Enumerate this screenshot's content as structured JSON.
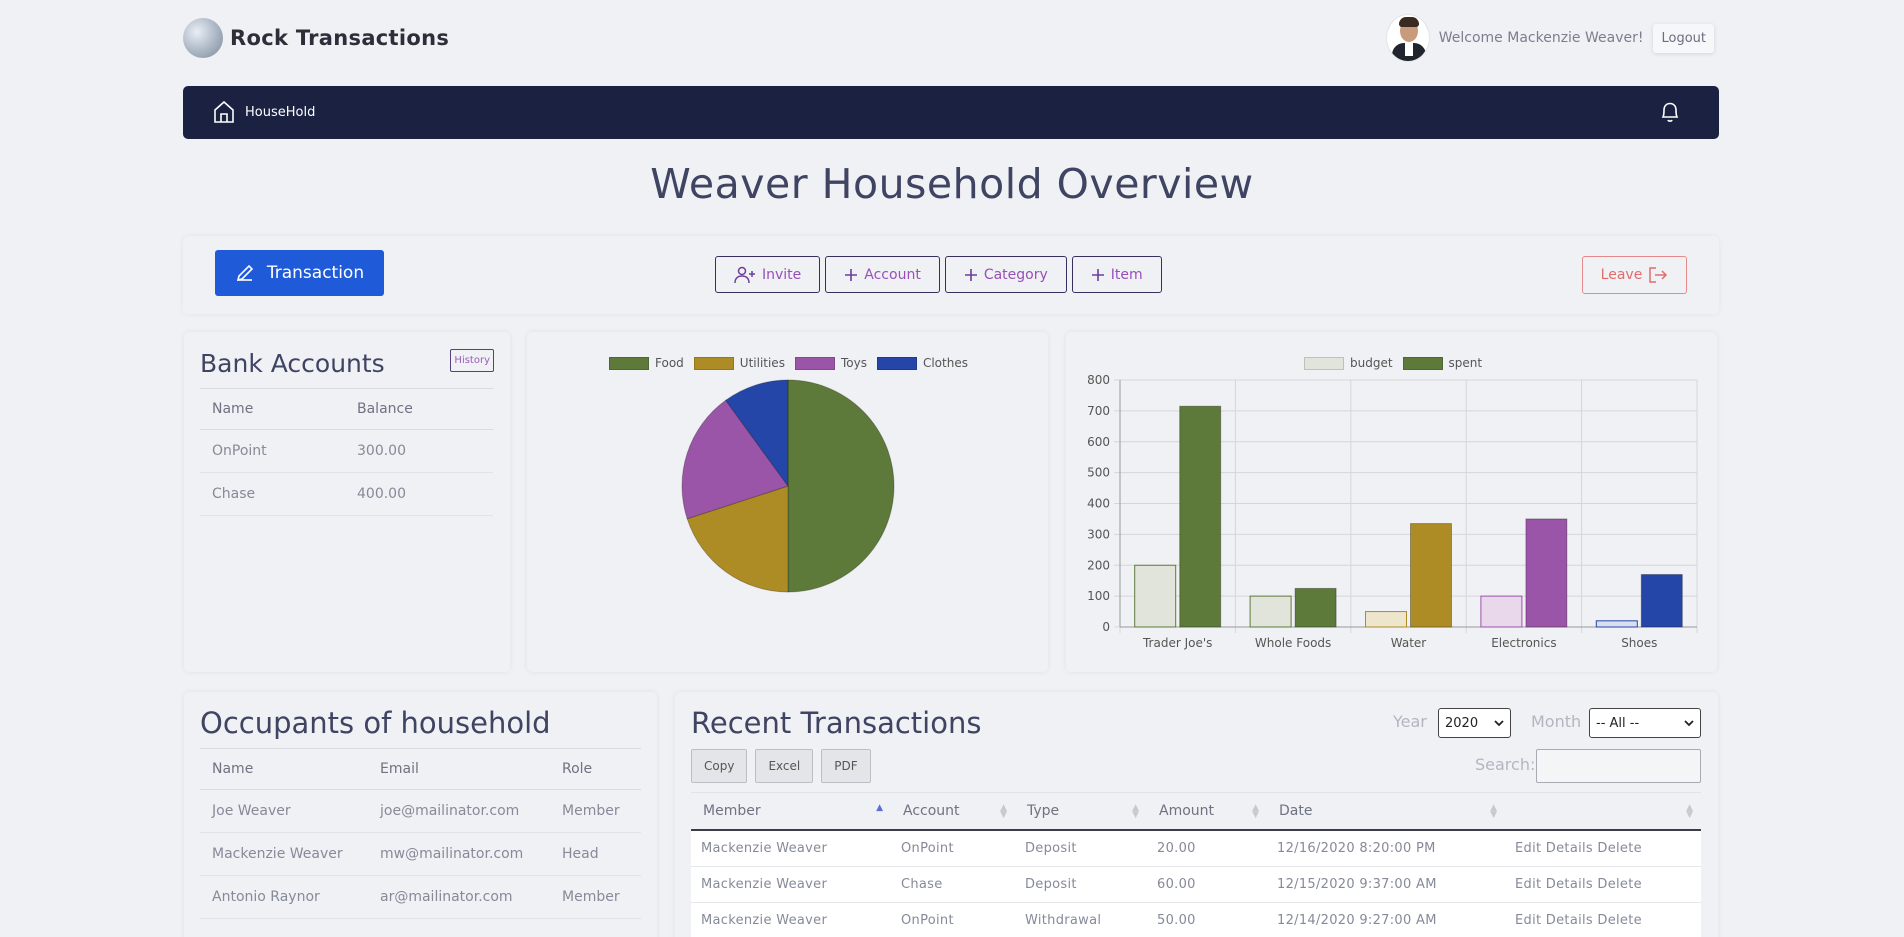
{
  "brand": {
    "name": "Rock Transactions"
  },
  "user": {
    "welcome": "Welcome Mackenzie Weaver!",
    "logout_label": "Logout"
  },
  "nav": {
    "home_label": "HouseHold"
  },
  "page": {
    "title": "Weaver Household Overview"
  },
  "actions": {
    "transaction_label": "Transaction",
    "invite_label": "Invite",
    "account_label": "Account",
    "category_label": "Category",
    "item_label": "Item",
    "leave_label": "Leave"
  },
  "bank": {
    "title": "Bank Accounts",
    "history_label": "History",
    "columns": [
      "Name",
      "Balance"
    ],
    "rows": [
      [
        "OnPoint",
        "300.00"
      ],
      [
        "Chase",
        "400.00"
      ]
    ]
  },
  "chart_data": [
    {
      "type": "pie",
      "categories": [
        "Food",
        "Utilities",
        "Toys",
        "Clothes"
      ],
      "values": [
        50,
        20,
        20,
        10
      ],
      "colors": [
        "#5e7a3a",
        "#ae8c25",
        "#9b55a8",
        "#2446a8"
      ],
      "legend": "top"
    },
    {
      "type": "bar",
      "categories": [
        "Trader Joe's",
        "Whole Foods",
        "Water",
        "Electronics",
        "Shoes"
      ],
      "series": [
        {
          "name": "budget",
          "values": [
            200,
            100,
            50,
            100,
            20
          ]
        },
        {
          "name": "spent",
          "values": [
            715,
            125,
            335,
            350,
            170
          ]
        }
      ],
      "ylim": [
        0,
        800
      ],
      "yticks": [
        0,
        100,
        200,
        300,
        400,
        500,
        600,
        700,
        800
      ],
      "grid": true,
      "legend": "top",
      "budget_colors": [
        "#e0e4da",
        "#e0e4da",
        "#ede6cc",
        "#e9d8ec",
        "#d9dfee"
      ],
      "spent_colors": [
        "#5e7a3a",
        "#5e7a3a",
        "#ae8c25",
        "#9b55a8",
        "#2446a8"
      ]
    }
  ],
  "occupants": {
    "title": "Occupants of household",
    "columns": [
      "Name",
      "Email",
      "Role"
    ],
    "rows": [
      [
        "Joe Weaver",
        "joe@mailinator.com",
        "Member"
      ],
      [
        "Mackenzie Weaver",
        "mw@mailinator.com",
        "Head"
      ],
      [
        "Antonio Raynor",
        "ar@mailinator.com",
        "Member"
      ]
    ]
  },
  "transactions": {
    "title": "Recent Transactions",
    "year_label": "Year",
    "year_value": "2020",
    "month_label": "Month",
    "month_value": "-- All --",
    "search_label": "Search:",
    "buttons": [
      "Copy",
      "Excel",
      "PDF"
    ],
    "columns": [
      "Member",
      "Account",
      "Type",
      "Amount",
      "Date",
      ""
    ],
    "rows": [
      [
        "Mackenzie Weaver",
        "OnPoint",
        "Deposit",
        "20.00",
        "12/16/2020 8:20:00 PM",
        "Edit Details Delete"
      ],
      [
        "Mackenzie Weaver",
        "Chase",
        "Deposit",
        "60.00",
        "12/15/2020 9:37:00 AM",
        "Edit Details Delete"
      ],
      [
        "Mackenzie Weaver",
        "OnPoint",
        "Withdrawal",
        "50.00",
        "12/14/2020 9:27:00 AM",
        "Edit Details Delete"
      ]
    ]
  }
}
